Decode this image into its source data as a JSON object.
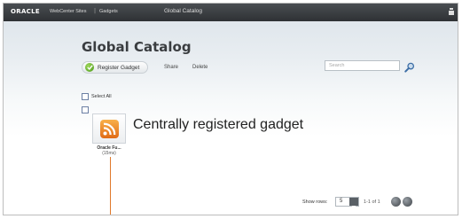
{
  "topbar": {
    "brand": "ORACLE",
    "product": "WebCenter Sites",
    "separator": "|",
    "tab": "Gadgets",
    "center_title": "Global Catalog"
  },
  "main": {
    "title": "Global Catalog",
    "register_label": "Register Gadget",
    "share_label": "Share",
    "delete_label": "Delete",
    "search_placeholder": "Search",
    "select_all_label": "Select All"
  },
  "gadget": {
    "name": "Oracle Fu...",
    "count": "(15ms)",
    "icon": "rss-feed-icon"
  },
  "annotation": {
    "text": "Centrally registered gadget",
    "line_color": "#e0782a"
  },
  "pagination": {
    "show_rows_label": "Show rows:",
    "rows_value": "5",
    "page_info": "1-1 of 1"
  },
  "colors": {
    "accent_green": "#4a9a1a",
    "rss_orange": "#e06b16",
    "topbar_dark": "#2e3134"
  }
}
